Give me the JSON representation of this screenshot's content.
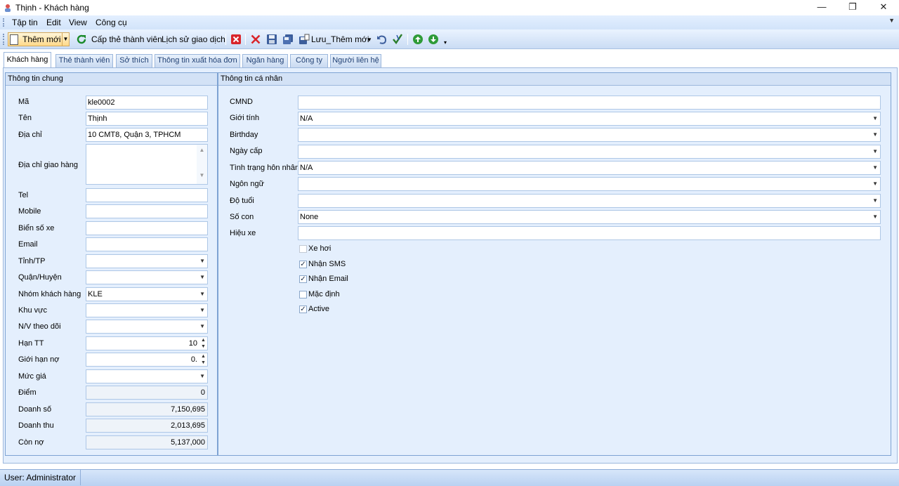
{
  "window": {
    "title": "Thịnh - Khách hàng",
    "controls": {
      "minimize": "—",
      "restore": "❐",
      "close": "✕"
    }
  },
  "menu": [
    "Tập tin",
    "Edit",
    "View",
    "Công cụ"
  ],
  "toolbar": {
    "new_label": "Thêm mới",
    "member_card_label": "Cấp thẻ thành viên",
    "history_label": "Lịch sử giao dịch",
    "save_new_label": "Lưu_Thêm mới"
  },
  "tabs": [
    "Khách hàng",
    "Thẻ thành viên",
    "Sở thích",
    "Thông tin xuất hóa đơn",
    "Ngân hàng",
    "Công ty",
    "Người liên hệ"
  ],
  "general": {
    "title": "Thông tin chung",
    "fields": {
      "ma": {
        "label": "Mã",
        "value": "kle0002"
      },
      "ten": {
        "label": "Tên",
        "value": "Thịnh"
      },
      "diachi": {
        "label": "Địa chỉ",
        "value": "10 CMT8, Quận 3, TPHCM"
      },
      "diachigiaohang": {
        "label": "Địa chỉ giao hàng",
        "value": ""
      },
      "tel": {
        "label": "Tel",
        "value": ""
      },
      "mobile": {
        "label": "Mobile",
        "value": ""
      },
      "bienso": {
        "label": "Biển số xe",
        "value": ""
      },
      "email": {
        "label": "Email",
        "value": ""
      },
      "tinh": {
        "label": "Tỉnh/TP",
        "value": ""
      },
      "quan": {
        "label": "Quận/Huyện",
        "value": ""
      },
      "nhom": {
        "label": "Nhóm khách hàng",
        "value": "KLE"
      },
      "khuvuc": {
        "label": "Khu vực",
        "value": ""
      },
      "nv": {
        "label": "N/V theo dõi",
        "value": ""
      },
      "hantt": {
        "label": "Hạn TT",
        "value": "10"
      },
      "gioihanno": {
        "label": "Giới hạn nợ",
        "value": "0."
      },
      "mucgia": {
        "label": "Mức giá",
        "value": ""
      },
      "diem": {
        "label": "Điểm",
        "value": "0"
      },
      "doanhso": {
        "label": "Doanh số",
        "value": "7,150,695"
      },
      "doanhthu": {
        "label": "Doanh thu",
        "value": "2,013,695"
      },
      "conno": {
        "label": "Còn nợ",
        "value": "5,137,000"
      }
    }
  },
  "personal": {
    "title": "Thông tin cá nhân",
    "fields": {
      "cmnd": {
        "label": "CMND",
        "value": ""
      },
      "gioitinh": {
        "label": "Giới tính",
        "value": "N/A"
      },
      "birthday": {
        "label": "Birthday",
        "value": ""
      },
      "ngaycap": {
        "label": "Ngày cấp",
        "value": ""
      },
      "honnhan": {
        "label": "Tình trạng hôn nhân",
        "value": "N/A"
      },
      "ngonngu": {
        "label": "Ngôn ngữ",
        "value": ""
      },
      "dotuoi": {
        "label": "Độ tuổi",
        "value": ""
      },
      "socon": {
        "label": "Số con",
        "value": "None"
      },
      "hieuxe": {
        "label": "Hiệu xe",
        "value": ""
      }
    },
    "checkboxes": {
      "xehoi": {
        "label": "Xe hơi",
        "checked": false
      },
      "sms": {
        "label": "Nhận SMS",
        "checked": true
      },
      "email": {
        "label": "Nhận Email",
        "checked": true
      },
      "macdinh": {
        "label": "Mặc định",
        "checked": false
      },
      "active": {
        "label": "Active",
        "checked": true
      }
    }
  },
  "status": {
    "user": "User: Administrator"
  }
}
